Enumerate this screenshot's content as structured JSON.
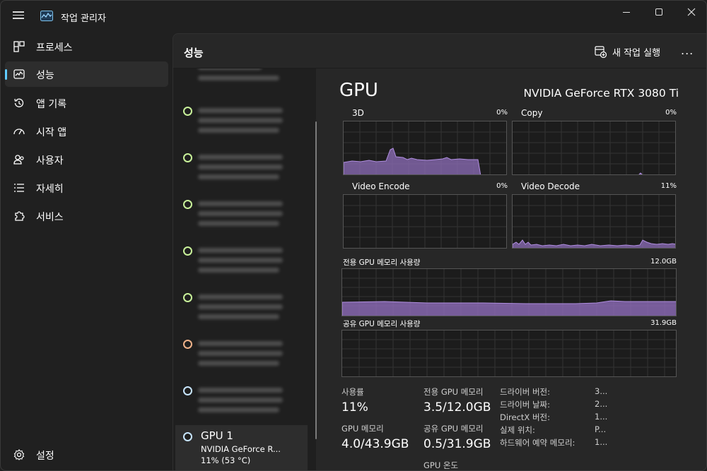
{
  "app": {
    "title": "작업 관리자"
  },
  "sidebar": {
    "items": [
      {
        "label": "프로세스",
        "icon": "processes-grid-icon"
      },
      {
        "label": "성능",
        "icon": "performance-chart-icon",
        "active": true
      },
      {
        "label": "앱 기록",
        "icon": "app-history-icon"
      },
      {
        "label": "시작 앱",
        "icon": "startup-gauge-icon"
      },
      {
        "label": "사용자",
        "icon": "users-icon"
      },
      {
        "label": "자세히",
        "icon": "details-list-icon"
      },
      {
        "label": "서비스",
        "icon": "services-puzzle-icon"
      }
    ],
    "settings_label": "설정"
  },
  "header": {
    "title": "성능",
    "run_task_label": "새 작업 실행",
    "more_label": "..."
  },
  "device_list": {
    "dot_colors": [
      "#c9f29a",
      "#c9f29a",
      "#c9f29a",
      "#c9f29a",
      "#c9f29a",
      "#f0b38a",
      "#c8e6ff"
    ],
    "selected": {
      "name": "GPU 1",
      "subtitle": "NVIDIA GeForce R...",
      "value": "11% (53 °C)"
    }
  },
  "gpu": {
    "heading": "GPU",
    "model": "NVIDIA GeForce RTX 3080 Ti",
    "engines": [
      {
        "name": "3D",
        "percent": "0%"
      },
      {
        "name": "Copy",
        "percent": "0%"
      },
      {
        "name": "Video Encode",
        "percent": "0%"
      },
      {
        "name": "Video Decode",
        "percent": "11%"
      }
    ],
    "dedicated_memory": {
      "label": "전용 GPU 메모리 사용량",
      "max": "12.0GB"
    },
    "shared_memory": {
      "label": "공유 GPU 메모리 사용량",
      "max": "31.9GB"
    },
    "stats": {
      "utilization_label": "사용률",
      "utilization_value": "11%",
      "dedicated_label": "전용 GPU 메모리",
      "dedicated_value": "3.5/12.0GB",
      "gpu_memory_label": "GPU 메모리",
      "gpu_memory_value": "4.0/43.9GB",
      "shared_label": "공유 GPU 메모리",
      "shared_value": "0.5/31.9GB",
      "temp_label": "GPU 온도"
    },
    "info": [
      {
        "key": "드라이버 버전:",
        "value": "3..."
      },
      {
        "key": "드라이버 날짜:",
        "value": "2..."
      },
      {
        "key": "DirectX 버전:",
        "value": "1..."
      },
      {
        "key": "실제 위치:",
        "value": "P..."
      },
      {
        "key": "하드웨어 예약 메모리:",
        "value": "1..."
      }
    ]
  },
  "colors": {
    "accent": "#60cdff",
    "graph_fill": "#8e6dba",
    "graph_line": "#b08ee0"
  }
}
